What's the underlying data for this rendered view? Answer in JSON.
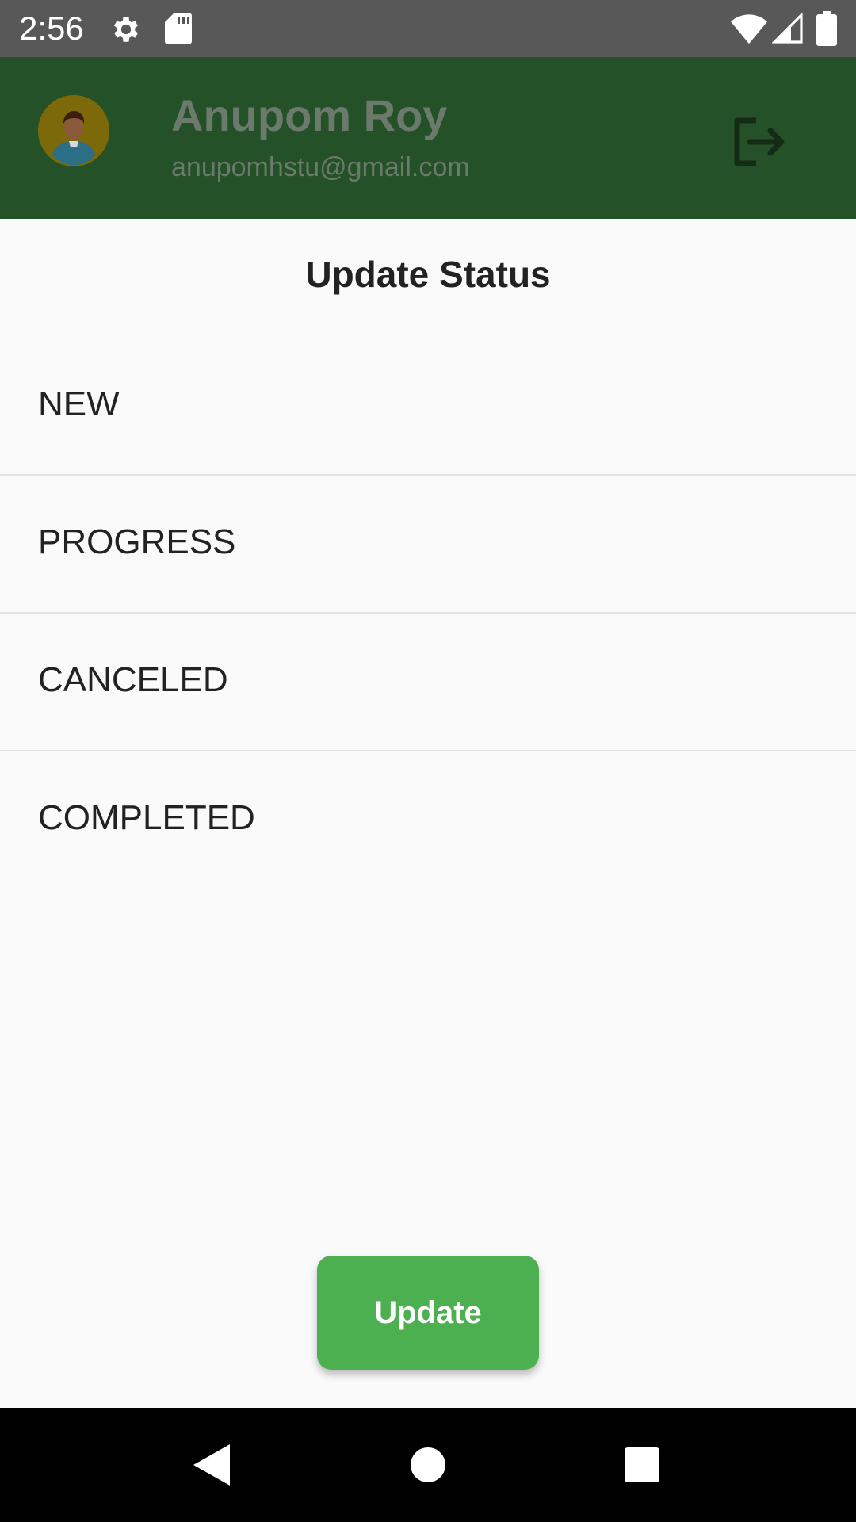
{
  "status_bar": {
    "time": "2:56",
    "icons": [
      "gear-icon",
      "sd-card-icon",
      "wifi-icon",
      "signal-icon",
      "battery-icon"
    ]
  },
  "header": {
    "user_name": "Anupom Roy",
    "email": "anupomhstu@gmail.com",
    "header_color": "#245127",
    "avatar_icon": "user-avatar",
    "logout_icon": "logout-icon"
  },
  "sheet": {
    "title": "Update Status",
    "options": [
      {
        "label": "NEW"
      },
      {
        "label": "PROGRESS"
      },
      {
        "label": "CANCELED"
      },
      {
        "label": "COMPLETED"
      }
    ],
    "update_label": "Update",
    "button_color": "#4caf50"
  },
  "nav_bar": {
    "icons": [
      "back-icon",
      "home-icon",
      "recent-apps-icon"
    ]
  }
}
